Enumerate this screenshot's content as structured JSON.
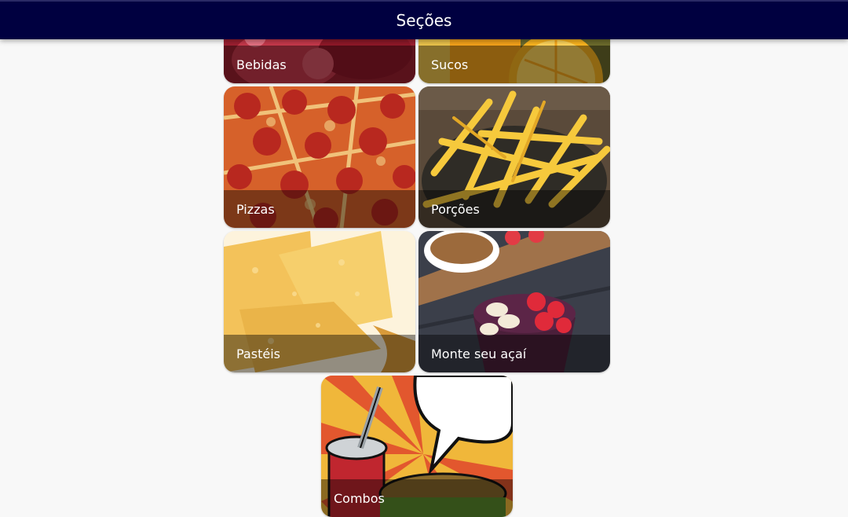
{
  "header": {
    "title": "Seções"
  },
  "sections": [
    {
      "label": "Bebidas",
      "icon": "drinks-photo"
    },
    {
      "label": "Sucos",
      "icon": "juices-photo"
    },
    {
      "label": "Pizzas",
      "icon": "pizza-photo"
    },
    {
      "label": "Porções",
      "icon": "fries-photo"
    },
    {
      "label": "Pastéis",
      "icon": "pastel-photo"
    },
    {
      "label": "Monte seu açaí",
      "icon": "acai-photo"
    },
    {
      "label": "Combos",
      "icon": "combo-illustration"
    }
  ],
  "colors": {
    "header_bg": "#000040",
    "page_bg": "#f8f8f8",
    "label_text": "#ffffff"
  }
}
